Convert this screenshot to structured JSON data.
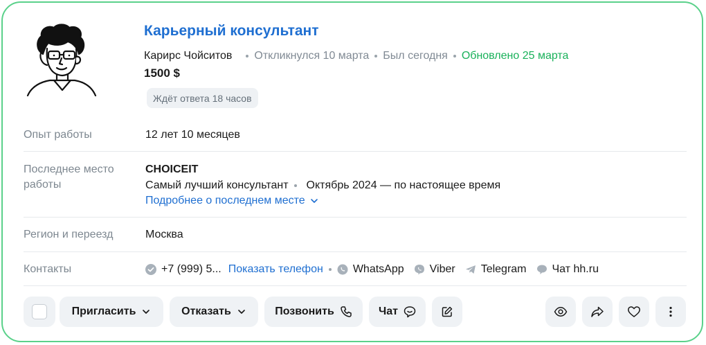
{
  "vacancy": {
    "title": "Карьерный консультант",
    "candidate_name": "Карирс Чойситов",
    "responded": "Откликнулся 10 марта",
    "last_seen": "Был сегодня",
    "updated": "Обновлено 25 марта",
    "salary": "1500 $",
    "waiting_badge": "Ждёт ответа 18 часов"
  },
  "details": {
    "experience": {
      "label": "Опыт работы",
      "value": "12 лет 10 месяцев"
    },
    "last_job": {
      "label_line1": "Последнее место",
      "label_line2": "работы",
      "company": "CHOICEIT",
      "position": "Самый лучший консультант",
      "period": "Октябрь 2024 — по настоящее время",
      "more_link": "Подробнее о последнем месте"
    },
    "region": {
      "label": "Регион и переезд",
      "value": "Москва"
    },
    "contacts": {
      "label": "Контакты",
      "phone": "+7 (999) 5...",
      "show_phone": "Показать телефон",
      "whatsapp": "WhatsApp",
      "viber": "Viber",
      "telegram": "Telegram",
      "chat": "Чат hh.ru"
    }
  },
  "actions": {
    "invite": "Пригласить",
    "reject": "Отказать",
    "call": "Позвонить",
    "chat": "Чат"
  },
  "colors": {
    "accent_blue": "#1f6fd1",
    "green": "#19b15a",
    "card_border": "#5ad18a",
    "button_bg": "#eff2f5"
  }
}
